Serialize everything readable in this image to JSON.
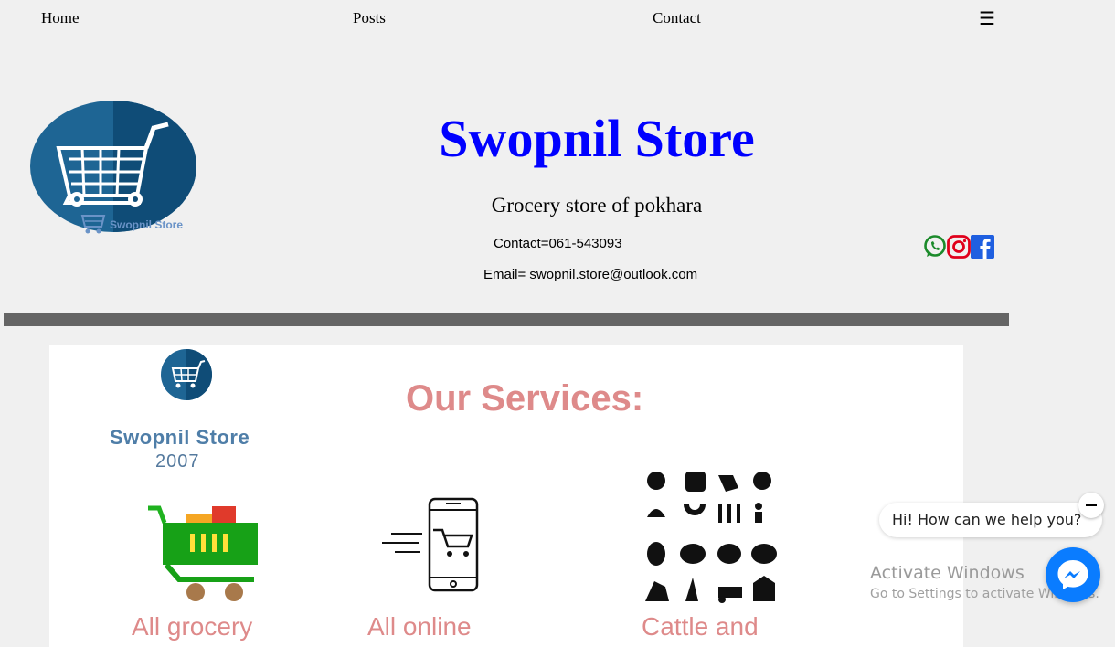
{
  "nav": {
    "home": "Home",
    "posts": "Posts",
    "contact": "Contact",
    "menu_icon": "☰"
  },
  "header": {
    "logo_text": "Swopnil Store",
    "title": "Swopnil Store",
    "subtitle": "Grocery store of pokhara",
    "contact": "Contact=061-543093",
    "email": "Email= swopnil.store@outlook.com"
  },
  "social": [
    {
      "name": "whatsapp-icon",
      "color": "#1b8a2a"
    },
    {
      "name": "instagram-icon",
      "color": "#e0001b"
    },
    {
      "name": "facebook-icon",
      "color": "#1877f2"
    }
  ],
  "banner": {
    "heading": "Our Services:",
    "brand": "Swopnil Store",
    "year": "2007",
    "services": [
      "All grocery",
      "All online",
      "Cattle and"
    ]
  },
  "chat": {
    "greeting": "Hi! How can we help you?"
  },
  "watermark": {
    "title": "Activate Windows",
    "subtitle": "Go to Settings to activate Windows."
  },
  "colors": {
    "title": "#0000ff",
    "divider": "#656565",
    "services_heading": "#de8a8a",
    "messenger": "#0a7cff"
  }
}
